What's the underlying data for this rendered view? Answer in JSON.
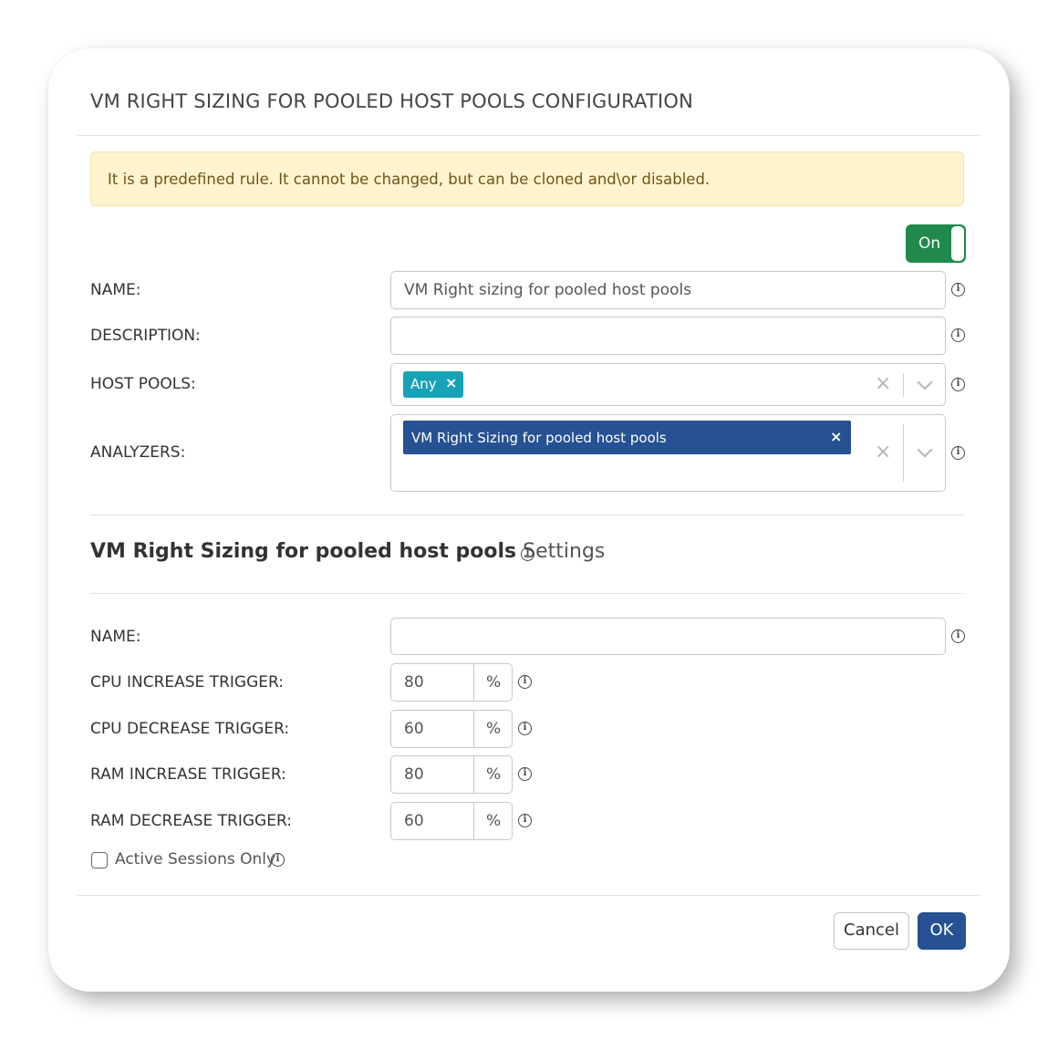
{
  "dialog": {
    "title": "VM RIGHT SIZING FOR POOLED HOST POOLS CONFIGURATION",
    "alert": "It is a predefined rule. It cannot be changed, but can be cloned and\\or disabled.",
    "toggle_label": "On"
  },
  "form": {
    "name_label": "NAME:",
    "name_value": "VM Right sizing for pooled host pools",
    "description_label": "DESCRIPTION:",
    "description_value": "",
    "host_pools_label": "HOST POOLS:",
    "host_pools_chips": [
      "Any"
    ],
    "analyzers_label": "ANALYZERS:",
    "analyzers_chips": [
      "VM Right Sizing for pooled host pools"
    ]
  },
  "settings": {
    "title_bold": "VM Right Sizing for pooled host pools",
    "title_light": "Settings",
    "name_label": "NAME:",
    "name_value": "",
    "triggers": [
      {
        "label": "CPU INCREASE TRIGGER:",
        "value": "80",
        "unit": "%"
      },
      {
        "label": "CPU DECREASE TRIGGER:",
        "value": "60",
        "unit": "%"
      },
      {
        "label": "RAM INCREASE TRIGGER:",
        "value": "80",
        "unit": "%"
      },
      {
        "label": "RAM DECREASE TRIGGER:",
        "value": "60",
        "unit": "%"
      }
    ],
    "active_sessions_label": "Active Sessions Only",
    "active_sessions_checked": false
  },
  "footer": {
    "cancel_label": "Cancel",
    "ok_label": "OK"
  },
  "icons": {
    "info": "info-icon",
    "clear": "clear-icon",
    "remove": "remove-chip-icon",
    "dropdown": "chevron-down-icon"
  },
  "colors": {
    "toggle_on": "#1f8a4c",
    "chip_any": "#17a2b8",
    "chip_analyzer": "#265192",
    "primary_button": "#265192",
    "alert_bg": "#fff4cd"
  }
}
